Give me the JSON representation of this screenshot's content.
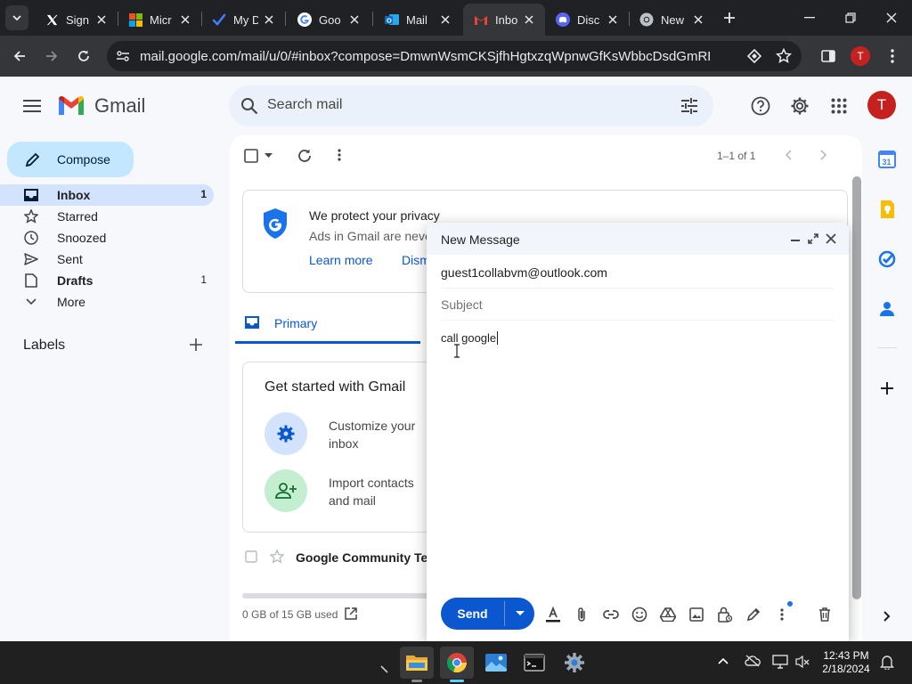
{
  "browser": {
    "tabs": [
      {
        "title": "Sign",
        "icon": "x-logo-icon"
      },
      {
        "title": "Micr",
        "icon": "microsoft-logo-icon"
      },
      {
        "title": "My D",
        "icon": "todo-check-icon"
      },
      {
        "title": "Goo",
        "icon": "google-g-icon"
      },
      {
        "title": "Mail",
        "icon": "outlook-icon"
      },
      {
        "title": "Inbo",
        "icon": "gmail-icon"
      },
      {
        "title": "Disc",
        "icon": "discord-icon"
      },
      {
        "title": "New",
        "icon": "chrome-icon"
      }
    ],
    "active_tab": 5,
    "url": "mail.google.com/mail/u/0/#inbox?compose=DmwnWsmCKSjfhHgtxzqWpnwGfKsWbbcDsdGmRBfwDWzRg...",
    "profile_initial": "T"
  },
  "gmail": {
    "logo_text": "Gmail",
    "search_placeholder": "Search mail",
    "avatar_initial": "T",
    "compose_label": "Compose",
    "nav": [
      {
        "label": "Inbox",
        "count": "1",
        "icon": "inbox-icon"
      },
      {
        "label": "Starred",
        "count": "",
        "icon": "star-icon"
      },
      {
        "label": "Snoozed",
        "count": "",
        "icon": "clock-icon"
      },
      {
        "label": "Sent",
        "count": "",
        "icon": "send-icon"
      },
      {
        "label": "Drafts",
        "count": "1",
        "icon": "draft-icon"
      },
      {
        "label": "More",
        "count": "",
        "icon": "chevron-down-icon"
      }
    ],
    "labels_heading": "Labels",
    "pagination": "1–1 of 1",
    "privacy": {
      "title": "We protect your privacy",
      "body": "Ads in Gmail are neve",
      "learn_more": "Learn more",
      "dismiss": "Dism"
    },
    "primary_tab": "Primary",
    "get_started": {
      "title": "Get started with Gmail",
      "items": [
        "Customize your inbox",
        "Import contacts and mail"
      ]
    },
    "email_row": {
      "sender": "Google Community Te"
    },
    "storage": "0 GB of 15 GB used"
  },
  "compose": {
    "title": "New Message",
    "to": "guest1collabvm@outlook.com",
    "subject_placeholder": "Subject",
    "body": "call google",
    "send_label": "Send"
  },
  "taskbar": {
    "time": "12:43 PM",
    "date": "2/18/2024"
  },
  "colors": {
    "compose_button": "#c2e7ff",
    "send_button": "#0b57d0",
    "active_nav": "#d3e3fd",
    "avatar": "#c5221f"
  }
}
